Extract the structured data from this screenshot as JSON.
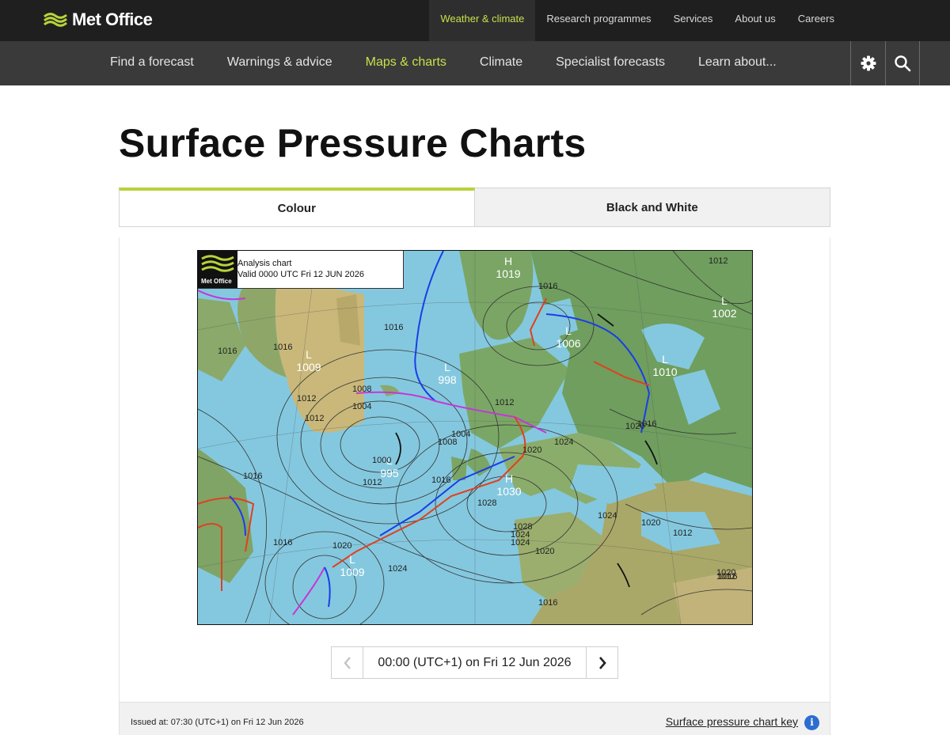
{
  "brand": {
    "name": "Met Office"
  },
  "top_links": [
    {
      "label": "Weather & climate",
      "active": true
    },
    {
      "label": "Research programmes"
    },
    {
      "label": "Services"
    },
    {
      "label": "About us"
    },
    {
      "label": "Careers"
    }
  ],
  "nav": {
    "items": [
      {
        "label": "Find a forecast"
      },
      {
        "label": "Warnings & advice"
      },
      {
        "label": "Maps & charts",
        "active": true
      },
      {
        "label": "Climate"
      },
      {
        "label": "Specialist forecasts"
      },
      {
        "label": "Learn about..."
      }
    ],
    "settings_icon": "gear-icon",
    "search_icon": "search-icon"
  },
  "page": {
    "title": "Surface Pressure Charts"
  },
  "tabs": [
    {
      "label": "Colour",
      "active": true
    },
    {
      "label": "Black and White"
    }
  ],
  "chart": {
    "label_line1": "Analysis chart",
    "label_line2": "Valid 0000 UTC Fri 12 JUN 2026",
    "logo_text": "Met Office",
    "systems": [
      {
        "type": "H",
        "value": "1019"
      },
      {
        "type": "L",
        "value": "1002"
      },
      {
        "type": "L",
        "value": "1006"
      },
      {
        "type": "L",
        "value": "1009"
      },
      {
        "type": "L",
        "value": "998"
      },
      {
        "type": "L",
        "value": "1010"
      },
      {
        "type": "L",
        "value": "995"
      },
      {
        "type": "H",
        "value": "1030"
      },
      {
        "type": "L",
        "value": "1009"
      }
    ],
    "isobar_labels": [
      "1012",
      "1016",
      "1016",
      "1016",
      "1012",
      "1016",
      "1008",
      "1004",
      "1004",
      "1012",
      "1020",
      "1024",
      "1020",
      "1016",
      "1000",
      "1008",
      "1012",
      "1016",
      "1028",
      "1024",
      "1028",
      "1024",
      "1020",
      "1024",
      "1020",
      "1016",
      "1012",
      "1012",
      "1016",
      "1016",
      "1020",
      "1024",
      "1020",
      "1016",
      "1012"
    ]
  },
  "stepper": {
    "current": "00:00 (UTC+1) on Fri 12 Jun 2026",
    "prev_icon": "chevron-left-icon",
    "next_icon": "chevron-right-icon"
  },
  "footer": {
    "issued": "Issued at: 07:30 (UTC+1) on Fri 12 Jun 2026",
    "key_link": "Surface pressure chart key",
    "info_icon": "info-icon",
    "info_glyph": "i"
  },
  "colors": {
    "accent": "#c8e04a",
    "tab_accent": "#b8d339",
    "sea": "#84c8df",
    "warm_front": "#e0401e",
    "cold_front": "#1a3ee8",
    "occluded_front": "#c636d8"
  }
}
